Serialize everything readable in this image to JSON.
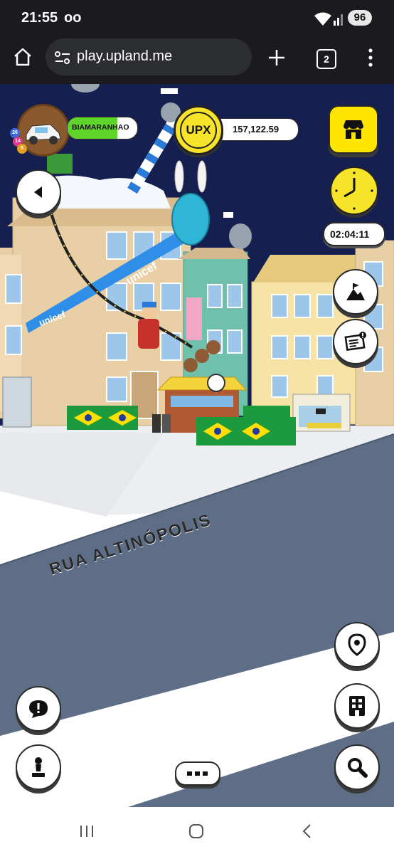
{
  "status_bar": {
    "time": "21:55",
    "voicemail": "oo",
    "battery": "96"
  },
  "browser": {
    "url": "play.upland.me",
    "tab_count": "2"
  },
  "game": {
    "player_name": "BIAMARANHAO",
    "currency_label": "UPX",
    "balance": "157,122.59",
    "timer": "02:04:11",
    "street_name": "RUA ALTINÓPOLIS",
    "banner_brand": "unicef",
    "avatar_badges": [
      "26",
      "14",
      "5"
    ],
    "icons": {
      "store": "store-icon",
      "clock": "clock-icon",
      "map_mode": "mountain-flag-icon",
      "news": "newspaper-icon",
      "back": "back-arrow-icon",
      "location": "location-pin-icon",
      "buildings": "building-icon",
      "search": "search-icon",
      "alert": "alert-bubble-icon",
      "character": "pawn-icon",
      "more": "more-dots-icon"
    },
    "colors": {
      "sky": "#152050",
      "street": "#5d6e86",
      "upx_yellow": "#f6e32a",
      "store_yellow": "#ffe600",
      "name_green": "#5fd42a"
    }
  }
}
